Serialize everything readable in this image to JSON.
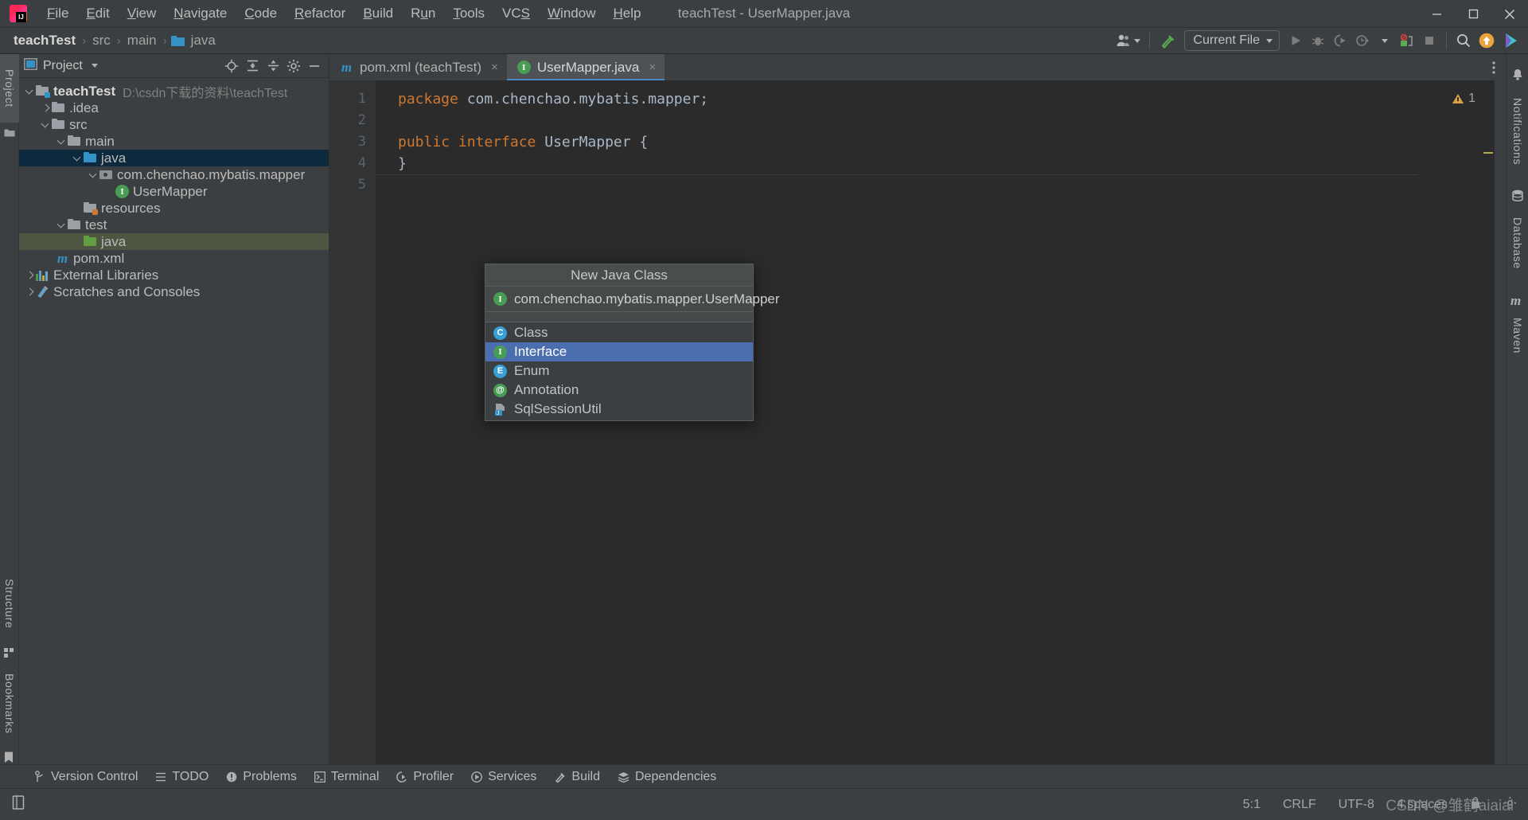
{
  "window": {
    "title": "teachTest - UserMapper.java",
    "app_icon": "intellij-idea-logo",
    "minimize": "minimize-icon",
    "maximize": "maximize-icon",
    "close": "close-icon"
  },
  "menubar": {
    "items": [
      {
        "label": "File",
        "mnemonic": "F"
      },
      {
        "label": "Edit",
        "mnemonic": "E"
      },
      {
        "label": "View",
        "mnemonic": "V"
      },
      {
        "label": "Navigate",
        "mnemonic": "N"
      },
      {
        "label": "Code",
        "mnemonic": "C"
      },
      {
        "label": "Refactor",
        "mnemonic": "R"
      },
      {
        "label": "Build",
        "mnemonic": "B"
      },
      {
        "label": "Run",
        "mnemonic": "u"
      },
      {
        "label": "Tools",
        "mnemonic": "T"
      },
      {
        "label": "VCS",
        "mnemonic": "S"
      },
      {
        "label": "Window",
        "mnemonic": "W"
      },
      {
        "label": "Help",
        "mnemonic": "H"
      }
    ]
  },
  "breadcrumbs": {
    "items": [
      "teachTest",
      "src",
      "main",
      "java"
    ],
    "separator": "›"
  },
  "toolbar": {
    "account_icon": "user-account-icon",
    "updates_icon": "hammer-build-icon",
    "run_config": "Current File",
    "run_icon": "run-icon",
    "debug_icon": "debug-icon",
    "run_with_coverage_icon": "run-coverage-icon",
    "profile_icon": "profile-icon",
    "more_run_icon": "chevron-down-icon",
    "stop_icon": "stop-icon",
    "ide_error_icon": "ide-error-icon",
    "search_everywhere_icon": "search-icon",
    "notification_icon": "update-available-icon",
    "feedback_icon": "ide-feedback-icon"
  },
  "left_strip": {
    "top": [
      {
        "label": "Project",
        "icon": "project-folder-icon",
        "selected": true
      }
    ],
    "bottom": [
      {
        "label": "Structure",
        "icon": "structure-icon"
      },
      {
        "label": "Bookmarks",
        "icon": "bookmark-icon"
      }
    ]
  },
  "right_strip": {
    "items": [
      {
        "label": "Notifications",
        "icon": "bell-icon"
      },
      {
        "label": "Database",
        "icon": "database-icon"
      },
      {
        "label": "Maven",
        "icon": "maven-icon"
      }
    ]
  },
  "project_panel": {
    "title": "Project",
    "dropdown_icon": "chevron-down-icon",
    "actions": [
      {
        "icon": "locate-target-icon",
        "name": "select-opened-file"
      },
      {
        "icon": "expand-all-icon",
        "name": "expand-all"
      },
      {
        "icon": "collapse-all-icon",
        "name": "collapse-all"
      },
      {
        "icon": "gear-icon",
        "name": "panel-settings"
      },
      {
        "icon": "hide-icon",
        "name": "hide-panel"
      }
    ],
    "tree": [
      {
        "label": "teachTest",
        "path": "D:\\csdn下载的资料\\teachTest",
        "icon": "module-folder-icon",
        "arrow": "down",
        "indent": 0,
        "bold": true
      },
      {
        "label": ".idea",
        "icon": "folder-icon",
        "arrow": "right",
        "indent": 1
      },
      {
        "label": "src",
        "icon": "folder-icon",
        "arrow": "down",
        "indent": 1
      },
      {
        "label": "main",
        "icon": "folder-icon",
        "arrow": "down",
        "indent": 2
      },
      {
        "label": "java",
        "icon": "source-root-folder-icon",
        "arrow": "down",
        "indent": 3,
        "selected": "blue"
      },
      {
        "label": "com.chenchao.mybatis.mapper",
        "icon": "package-icon",
        "arrow": "down",
        "indent": 4
      },
      {
        "label": "UserMapper",
        "icon": "interface-icon",
        "arrow": "none",
        "indent": 5
      },
      {
        "label": "resources",
        "icon": "resource-root-folder-icon",
        "arrow": "none",
        "indent": 3
      },
      {
        "label": "test",
        "icon": "folder-icon",
        "arrow": "down",
        "indent": 2
      },
      {
        "label": "java",
        "icon": "test-source-root-folder-icon",
        "arrow": "none",
        "indent": 3,
        "selected": "green"
      },
      {
        "label": "pom.xml",
        "icon": "maven-icon",
        "arrow": "none",
        "indent": 2
      },
      {
        "label": "External Libraries",
        "icon": "libraries-icon",
        "arrow": "right",
        "indent": 0
      },
      {
        "label": "Scratches and Consoles",
        "icon": "scratches-icon",
        "arrow": "right",
        "indent": 0
      }
    ]
  },
  "editor": {
    "tabs": [
      {
        "label": "pom.xml (teachTest)",
        "icon": "maven-file-icon",
        "active": false,
        "close": "×"
      },
      {
        "label": "UserMapper.java",
        "icon": "interface-icon",
        "active": true,
        "close": "×"
      }
    ],
    "options_icon": "more-options-icon",
    "line_numbers": [
      "1",
      "2",
      "3",
      "4",
      "5"
    ],
    "lines": [
      [
        {
          "t": "package",
          "c": "kw"
        },
        {
          "t": " com.chenchao.mybatis.mapper;",
          "c": "pl"
        }
      ],
      [],
      [
        {
          "t": "public interface",
          "c": "kw"
        },
        {
          "t": " UserMapper {",
          "c": "pl"
        }
      ],
      [
        {
          "t": "}",
          "c": "pl"
        }
      ],
      []
    ],
    "warning_count": "1",
    "warning_icon": "warning-triangle-icon"
  },
  "popup": {
    "title": "New Java Class",
    "input_value": "com.chenchao.mybatis.mapper.UserMapper",
    "input_icon": "interface-icon",
    "items": [
      {
        "label": "Class",
        "icon": "class-icon",
        "glyph": "C",
        "selected": false
      },
      {
        "label": "Interface",
        "icon": "interface-icon",
        "glyph": "I",
        "selected": true
      },
      {
        "label": "Enum",
        "icon": "enum-icon",
        "glyph": "E",
        "selected": false
      },
      {
        "label": "Annotation",
        "icon": "annotation-icon",
        "glyph": "@",
        "selected": false
      },
      {
        "label": "SqlSessionUtil",
        "icon": "java-file-icon",
        "glyph": "",
        "selected": false
      }
    ]
  },
  "bottom_bar": {
    "items": [
      {
        "label": "Version Control",
        "icon": "branch-icon"
      },
      {
        "label": "TODO",
        "icon": "todo-list-icon"
      },
      {
        "label": "Problems",
        "icon": "problems-icon"
      },
      {
        "label": "Terminal",
        "icon": "terminal-icon"
      },
      {
        "label": "Profiler",
        "icon": "profiler-icon"
      },
      {
        "label": "Services",
        "icon": "services-icon"
      },
      {
        "label": "Build",
        "icon": "build-hammer-icon"
      },
      {
        "label": "Dependencies",
        "icon": "dependencies-icon"
      }
    ]
  },
  "status_bar": {
    "left_icon": "toggle-toolwindows-icon",
    "caret_position": "5:1",
    "line_separator": "CRLF",
    "encoding": "UTF-8",
    "indent": "4 spaces",
    "lock_icon": "read-only-icon",
    "inspections_icon": "inspections-gear-icon",
    "watermark": "CSDN @雏鹤aiaiai"
  },
  "colors": {
    "accent_blue": "#4b6eaf",
    "panel_bg": "#3c3f41",
    "editor_bg": "#2b2b2b",
    "keyword_orange": "#cc7832",
    "text_grey": "#bbbbbb",
    "selection_blue": "#0d293e",
    "selection_green": "#4e5643",
    "interface_green": "#499c54",
    "class_blue": "#389fd6",
    "warning_yellow": "#d9a343"
  }
}
